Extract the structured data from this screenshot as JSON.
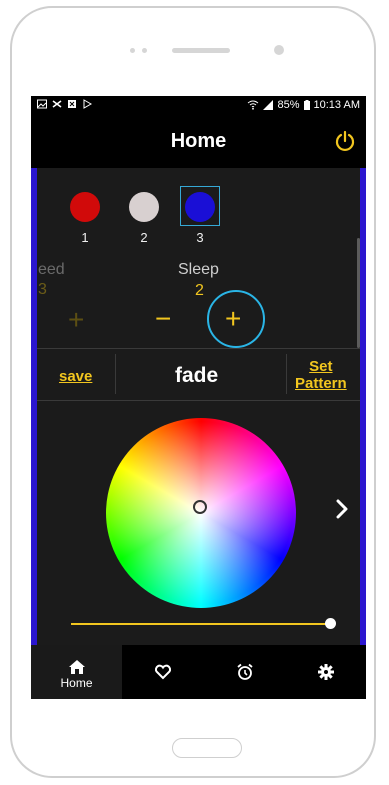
{
  "status_bar": {
    "battery": "85%",
    "time": "10:13 AM"
  },
  "header": {
    "title": "Home"
  },
  "swatches": [
    {
      "label": "1",
      "color": "#d10a0a"
    },
    {
      "label": "2",
      "color": "#d8d0d0"
    },
    {
      "label": "3",
      "color": "#1a0fd6",
      "selected": true
    }
  ],
  "settings_carousel": {
    "prev_label": "eed",
    "prev_value": "3",
    "current_label": "Sleep",
    "current_value": "2"
  },
  "controls": {
    "minus": "−",
    "plus": "+"
  },
  "actions": {
    "save": "save",
    "mode": "fade",
    "set_pattern_line1": "Set",
    "set_pattern_line2": "Pattern"
  },
  "brightness_level": 1.0,
  "tabs": [
    {
      "label": "Home",
      "icon": "home-icon",
      "active": true
    },
    {
      "label": "",
      "icon": "heart-icon"
    },
    {
      "label": "",
      "icon": "alarm-clock-icon"
    },
    {
      "label": "",
      "icon": "gear-icon"
    }
  ],
  "colors": {
    "accent": "#f2c61f",
    "focus_ring": "#2ab5e6",
    "edge": "#2b16cf",
    "background": "#1b1b1b"
  }
}
